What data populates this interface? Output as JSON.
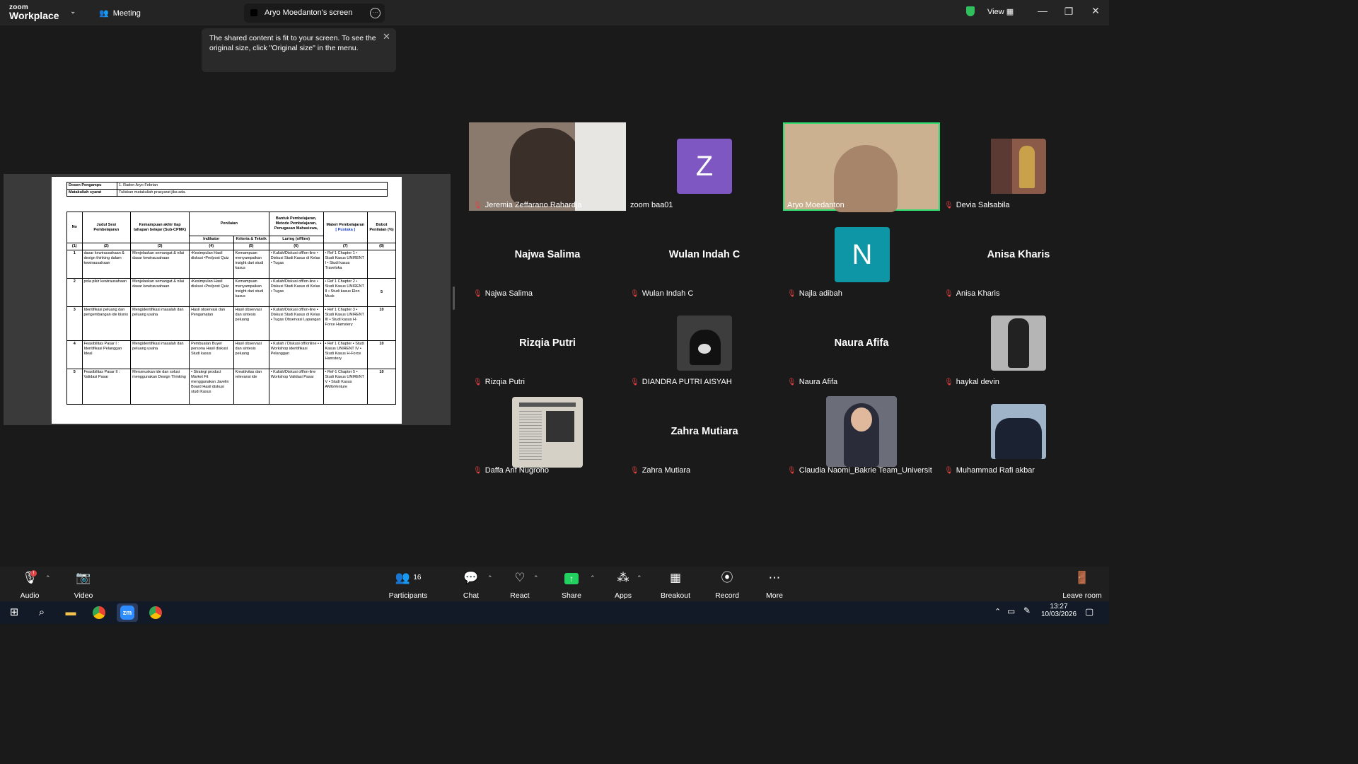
{
  "app": {
    "brand_top": "zoom",
    "brand_bottom": "Workplace",
    "meeting_label": "Meeting",
    "screen_tab": "Aryo Moedanton's screen",
    "view_label": "View"
  },
  "tooltip": {
    "text": "The shared content is fit to your screen. To see the original size, click \"Original size\" in the menu."
  },
  "doc": {
    "header_rows": [
      {
        "label": "Dosen Pengampu",
        "value": "1.   Raden Aryo Febrian"
      },
      {
        "label": "Matakuliah syarat",
        "value": "Tuliskan matakuliah prasyarat jika ada."
      }
    ],
    "col_headers": {
      "no": "No",
      "judul": "Judul Sesi Pembelajaran",
      "kemampuan": "Kemampuan akhir tiap tahapan belajar (Sub-CPMK)",
      "penilaian": "Penilaian",
      "indikator": "Indikator",
      "kriteria": "Kriteria & Teknik",
      "bantuk": "Bantuk Pembelajaran, Metode Pembelajaran, Penugasan Mahasiswa,",
      "luring": "Luring (offline)",
      "materi": "Materi Pembelajaran",
      "pustaka": "[ Pustaka ]",
      "bobot": "Bobot Penilaian (%)"
    },
    "col_numbers": [
      "(1)",
      "(2)",
      "(3)",
      "(4)",
      "(5)",
      "(6)",
      "(7)",
      "(8)"
    ],
    "rows": [
      {
        "no": "1",
        "judul": "dasar kewirausahaan & design thinking dalam kewirausahaan",
        "kemampuan": "Menjelaskan semangat & nilai dasar kewirausahaan",
        "indikator": "•Kesimpulan Hasil diskusi •Pre/post Quiz",
        "kriteria": "Kemampuan menyampaikan insight dari studi kasus",
        "luring": "• Kuliah/Diskusi off/on-line • Diskusi Studi Kasus di Kelas • Tugas",
        "materi": "• Ref 1 Chapter 1 • Studi Kasus UNIRENT I • Studi kasus Traveloka",
        "bobot": ""
      },
      {
        "no": "2",
        "judul": "pola pikir kewirausahaan",
        "kemampuan": "Menjelaskan semangat & nilai dasar kewirausahaan",
        "indikator": "•Kesimpulan Hasil diskusi •Pre/post Quiz",
        "kriteria": "Kemampuan menyampaikan insight dari studi kasus",
        "luring": "• Kuliah/Diskusi off/on-line • Diskusi Studi Kasus di Kelas • Tugas",
        "materi": "• Ref 1 Chapter 2 • Studi Kasus UNIRENT II • Studi kasus Elon Musk",
        "bobot": "5"
      },
      {
        "no": "3",
        "judul": "Identifikasi peluang dan pengembangan ide bisnis",
        "kemampuan": "Mengidentifikasi masalah dan peluang usaha",
        "indikator": "Hasil observasi dan Pengamatan",
        "kriteria": "Hasil observasi dan sintesis peluang",
        "luring": "• Kuliah/Diskusi off/on-line • Diskusi Studi Kasus di Kelas • Tugas Observasi Lapangan",
        "materi": "• Ref 1 Chapter 3 • Studi Kasus UNIRENT III • Studi kasus H-Force Hamstery",
        "bobot": "10"
      },
      {
        "no": "4",
        "judul": "Feasibilitas Pasar I : Identifikasi Pelanggan Ideal",
        "kemampuan": "Mengidentifikasi masalah dan peluang usaha",
        "indikator": "Pembuatan Buyer persona Hasil diskusi Studi kasus",
        "kriteria": "Hasil observasi dan sintesis peluang",
        "luring": "• Kuliah / Diskusi off/online • • Workshop identifikasi Pelanggan",
        "materi": "• Ref 1 Chapter • Studi Kasus UNIRENT IV • Studi Kasus H-Force Hamstery",
        "bobot": "10"
      },
      {
        "no": "5",
        "judul": "Feasibilitas Pasar II : Validasi Pasar",
        "kemampuan": "Merumuskan ide dan solusi menggunakan Design Thinking",
        "indikator": "• Strategi product Market Fit menggunakan Javelin Board Hasil diskusi studi Kasus",
        "kriteria": "Kreatiivitas dan relevansi ide",
        "luring": "• Kuliah/Diskusi off/on-line Workshop Validasi Pasar",
        "materi": "• Ref-1 Chapter 5 • Studi Kasus UNIRENT V • Studi Kasus AMGVenture",
        "bobot": "10"
      }
    ]
  },
  "participants": [
    {
      "name": "Jeremia Zeffarano Rahardja",
      "kind": "video",
      "muted": true,
      "bg": "#8a7a6e"
    },
    {
      "name": "zoom baa01",
      "kind": "avatar",
      "letter": "Z",
      "color": "#7e57c2",
      "muted": false
    },
    {
      "name": "Aryo Moedanton",
      "kind": "video",
      "muted": false,
      "bg": "#b79a7c",
      "active": true
    },
    {
      "name": "Devia Salsabila",
      "kind": "photo",
      "muted": true,
      "bg": "#8c5a48"
    },
    {
      "name": "Najwa Salima",
      "kind": "text",
      "display": "Najwa Salima",
      "muted": true
    },
    {
      "name": "Wulan Indah C",
      "kind": "text",
      "display": "Wulan Indah C",
      "muted": true
    },
    {
      "name": "Najla adibah",
      "kind": "avatar",
      "letter": "N",
      "color": "#0e96a6",
      "muted": true
    },
    {
      "name": "Anisa Kharis",
      "kind": "text",
      "display": "Anisa Kharis",
      "muted": true
    },
    {
      "name": "Rizqia Putri",
      "kind": "text",
      "display": "Rizqia Putri",
      "muted": true
    },
    {
      "name": "DIANDRA PUTRI AISYAH",
      "kind": "photo",
      "muted": true,
      "bg": "#3d3d3d"
    },
    {
      "name": "Naura Afifa",
      "kind": "text",
      "display": "Naura Afifa",
      "muted": true
    },
    {
      "name": "haykal devin",
      "kind": "photo",
      "muted": true,
      "bg": "#a9a9a9"
    },
    {
      "name": "Daffa Arif Nugroho",
      "kind": "photo",
      "muted": true,
      "bg": "#cfcabf"
    },
    {
      "name": "Zahra Mutiara",
      "kind": "text",
      "display": "Zahra Mutiara",
      "muted": true
    },
    {
      "name": "Claudia Naomi_Bakrie Team_Universitas ...",
      "kind": "photo",
      "muted": true,
      "bg": "#6b6d78"
    },
    {
      "name": "Muhammad Rafi akbar",
      "kind": "photo",
      "muted": true,
      "bg": "#9fb4c8"
    }
  ],
  "toolbar": {
    "audio": "Audio",
    "video": "Video",
    "participants": "Participants",
    "participant_count": "16",
    "chat": "Chat",
    "react": "React",
    "share": "Share",
    "apps": "Apps",
    "breakout": "Breakout rooms",
    "record": "Record",
    "more": "More",
    "leave": "Leave room"
  },
  "taskbar": {
    "time": "13:27",
    "date": "10/03/2026"
  },
  "colors": {
    "active_border": "#2fdc70",
    "share_green": "#23d160",
    "muted_red": "#e04343"
  }
}
